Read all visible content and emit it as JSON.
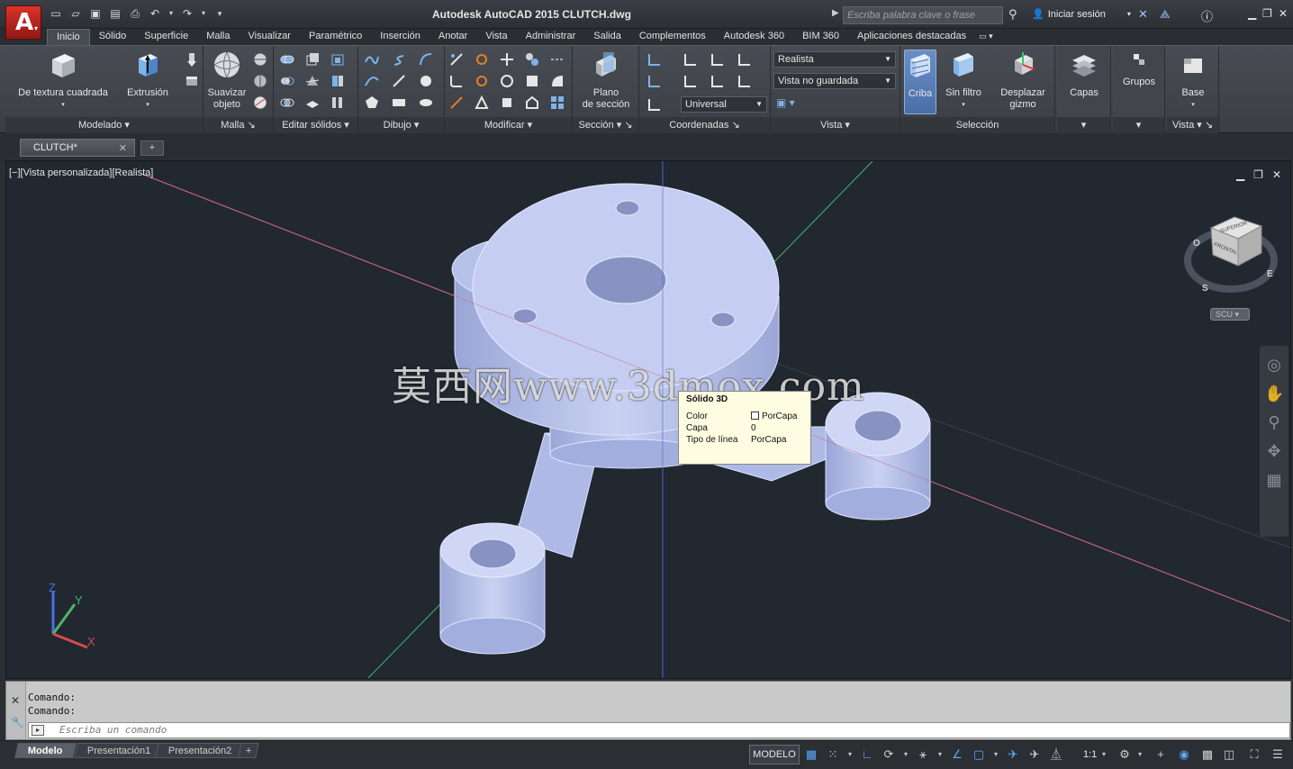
{
  "titlebar": {
    "title": "Autodesk AutoCAD 2015    CLUTCH.dwg",
    "search_placeholder": "Escriba palabra clave o frase",
    "signin_label": "Iniciar sesión"
  },
  "ribbon_tabs": [
    "Inicio",
    "Sólido",
    "Superficie",
    "Malla",
    "Visualizar",
    "Paramétrico",
    "Inserción",
    "Anotar",
    "Vista",
    "Administrar",
    "Salida",
    "Complementos",
    "Autodesk 360",
    "BIM 360",
    "Aplicaciones destacadas"
  ],
  "ribbon": {
    "modelado": {
      "box_label": "De textura cuadrada",
      "extrude_label": "Extrusión",
      "title": "Modelado"
    },
    "malla": {
      "smooth_label_1": "Suavizar",
      "smooth_label_2": "objeto",
      "title": "Malla"
    },
    "editar_solidos_title": "Editar sólidos",
    "dibujo_title": "Dibujo",
    "modificar_title": "Modificar",
    "seccion": {
      "plane_label_1": "Plano",
      "plane_label_2": "de sección",
      "title": "Sección"
    },
    "coordenadas": {
      "ucs_value": "Universal",
      "title": "Coordenadas"
    },
    "vista": {
      "visual_style": "Realista",
      "named_view": "Vista no guardada",
      "title": "Vista"
    },
    "seleccion": {
      "cull_label": "Criba",
      "nofilter_label": "Sin filtro",
      "gizmo_label_1": "Desplazar",
      "gizmo_label_2": "gizmo",
      "title": "Selección"
    },
    "capas_label": "Capas",
    "grupos_label": "Grupos",
    "vista2": {
      "base_label": "Base",
      "title": "Vista"
    }
  },
  "file_tabs": {
    "active": "CLUTCH*"
  },
  "viewport": {
    "label": "[−][Vista personalizada][Realista]",
    "watermark": "莫西网www.3dmox.com",
    "scu_label": "SCU",
    "viewcube": {
      "top": "SUPERIOR",
      "front": "FRONTAL",
      "west": "O",
      "south": "S",
      "east": "E"
    },
    "axis_z": "Z",
    "axis_y": "Y",
    "axis_x": "X"
  },
  "tooltip": {
    "title": "Sólido 3D",
    "rows": [
      {
        "key": "Color",
        "value": "PorCapa"
      },
      {
        "key": "Capa",
        "value": "0"
      },
      {
        "key": "Tipo de línea",
        "value": "PorCapa"
      }
    ]
  },
  "command": {
    "history": [
      "Comando:",
      "Comando:"
    ],
    "placeholder": "Escriba un comando"
  },
  "layout_tabs": [
    "Modelo",
    "Presentación1",
    "Presentación2"
  ],
  "status": {
    "model_label": "MODELO",
    "scale": "1:1"
  }
}
